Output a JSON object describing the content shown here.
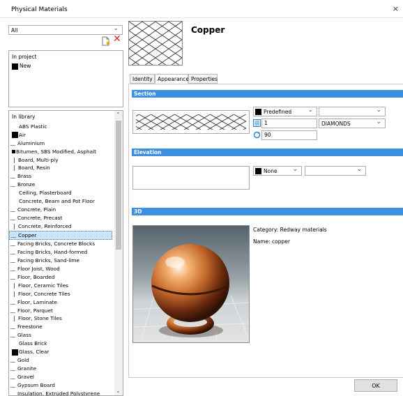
{
  "window": {
    "title": "Physical Materials",
    "close_glyph": "×"
  },
  "filter": {
    "selected": "All"
  },
  "project": {
    "header": "In project",
    "items": [
      {
        "label": "New",
        "swatch": "#000000"
      }
    ]
  },
  "library": {
    "header": "In library",
    "selected_index": 14,
    "items": [
      {
        "label": "ABS Plastic",
        "icon": "blank"
      },
      {
        "label": "Air",
        "icon": "black-swatch"
      },
      {
        "label": "Aluminium",
        "icon": "curve"
      },
      {
        "label": "Bitumen, SBS Modified, Asphalt",
        "icon": "small-square"
      },
      {
        "label": "Board, Multi-ply",
        "icon": "vline"
      },
      {
        "label": "Board, Resin",
        "icon": "vline"
      },
      {
        "label": "Brass",
        "icon": "diag"
      },
      {
        "label": "Bronze",
        "icon": "diag"
      },
      {
        "label": "Ceiling, Plasterboard",
        "icon": "blank"
      },
      {
        "label": "Concrete, Beam and Pot Floor",
        "icon": "blank"
      },
      {
        "label": "Concrete, Plain",
        "icon": "dots"
      },
      {
        "label": "Concrete, Precast",
        "icon": "diag"
      },
      {
        "label": "Concrete, Reinforced",
        "icon": "vline"
      },
      {
        "label": "Copper",
        "icon": "diag"
      },
      {
        "label": "Facing Bricks, Concrete Blocks",
        "icon": "diag"
      },
      {
        "label": "Facing Bricks, Hand-formed",
        "icon": "diag"
      },
      {
        "label": "Facing Bricks, Sand-lime",
        "icon": "diag"
      },
      {
        "label": "Floor Joist, Wood",
        "icon": "diag"
      },
      {
        "label": "Floor, Boarded",
        "icon": "diag"
      },
      {
        "label": "Floor, Ceramic Tiles",
        "icon": "vline"
      },
      {
        "label": "Floor, Concrete Tiles",
        "icon": "vline"
      },
      {
        "label": "Floor, Laminate",
        "icon": "diag"
      },
      {
        "label": "Floor, Parquet",
        "icon": "diag"
      },
      {
        "label": "Floor, Stone Tiles",
        "icon": "vline"
      },
      {
        "label": "Freestone",
        "icon": "diag"
      },
      {
        "label": "Glass",
        "icon": "diag"
      },
      {
        "label": "Glass Brick",
        "icon": "blank"
      },
      {
        "label": "Glass, Clear",
        "icon": "black-swatch"
      },
      {
        "label": "Gold",
        "icon": "diag"
      },
      {
        "label": "Granite",
        "icon": "diag"
      },
      {
        "label": "Gravel",
        "icon": "dots"
      },
      {
        "label": "Gypsum Board",
        "icon": "diag"
      },
      {
        "label": "Insulation, Extruded Polystyrene",
        "icon": "diag"
      }
    ]
  },
  "material": {
    "name": "Copper"
  },
  "tabs": [
    "Identity",
    "Appearance",
    "Properties"
  ],
  "active_tab": "Appearance",
  "section": {
    "header": "Section",
    "color_mode": "Predefined",
    "pattern_type": "",
    "scale": "1",
    "pattern": "DIAMONDS",
    "angle": "90"
  },
  "elevation": {
    "header": "Elevation",
    "color_mode": "None",
    "pattern": ""
  },
  "render3d": {
    "header": "3D",
    "category_label": "Category:",
    "category_value": "Redway materials",
    "name_label": "Name:",
    "name_value": "copper"
  },
  "footer": {
    "ok_label": "OK"
  },
  "colors": {
    "accent_bar": "#3d8fe0",
    "delete_red": "#e0251b",
    "selection": "#cce4f7"
  }
}
